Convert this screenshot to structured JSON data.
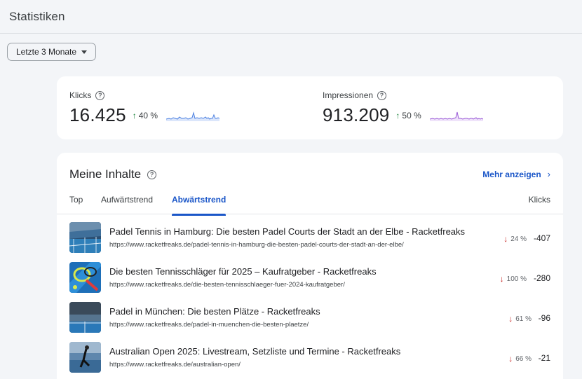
{
  "header": {
    "title": "Statistiken"
  },
  "range": {
    "selected": "Letzte 3 Monate"
  },
  "metrics": [
    {
      "label": "Klicks",
      "value": "16.425",
      "change": "40 %",
      "color": "#4a7fe0"
    },
    {
      "label": "Impressionen",
      "value": "913.209",
      "change": "50 %",
      "color": "#9a5ad6"
    }
  ],
  "content": {
    "title": "Meine Inhalte",
    "more_label": "Mehr anzeigen",
    "tabs": [
      {
        "label": "Top",
        "active": false
      },
      {
        "label": "Aufwärtstrend",
        "active": false
      },
      {
        "label": "Abwärtstrend",
        "active": true
      }
    ],
    "column_header": "Klicks",
    "rows": [
      {
        "title": "Padel Tennis in Hamburg: Die besten Padel Courts der Stadt an der Elbe - Racketfreaks",
        "url": "https://www.racketfreaks.de/padel-tennis-in-hamburg-die-besten-padel-courts-der-stadt-an-der-elbe/",
        "pct": "24 %",
        "value": "-407"
      },
      {
        "title": "Die besten Tennisschläger für 2025 – Kaufratgeber - Racketfreaks",
        "url": "https://www.racketfreaks.de/die-besten-tennisschlaeger-fuer-2024-kaufratgeber/",
        "pct": "100 %",
        "value": "-280"
      },
      {
        "title": "Padel in München: Die besten Plätze - Racketfreaks",
        "url": "https://www.racketfreaks.de/padel-in-muenchen-die-besten-plaetze/",
        "pct": "61 %",
        "value": "-96"
      },
      {
        "title": "Australian Open 2025: Livestream, Setzliste und Termine - Racketfreaks",
        "url": "https://www.racketfreaks.de/australian-open/",
        "pct": "66 %",
        "value": "-21"
      }
    ]
  }
}
